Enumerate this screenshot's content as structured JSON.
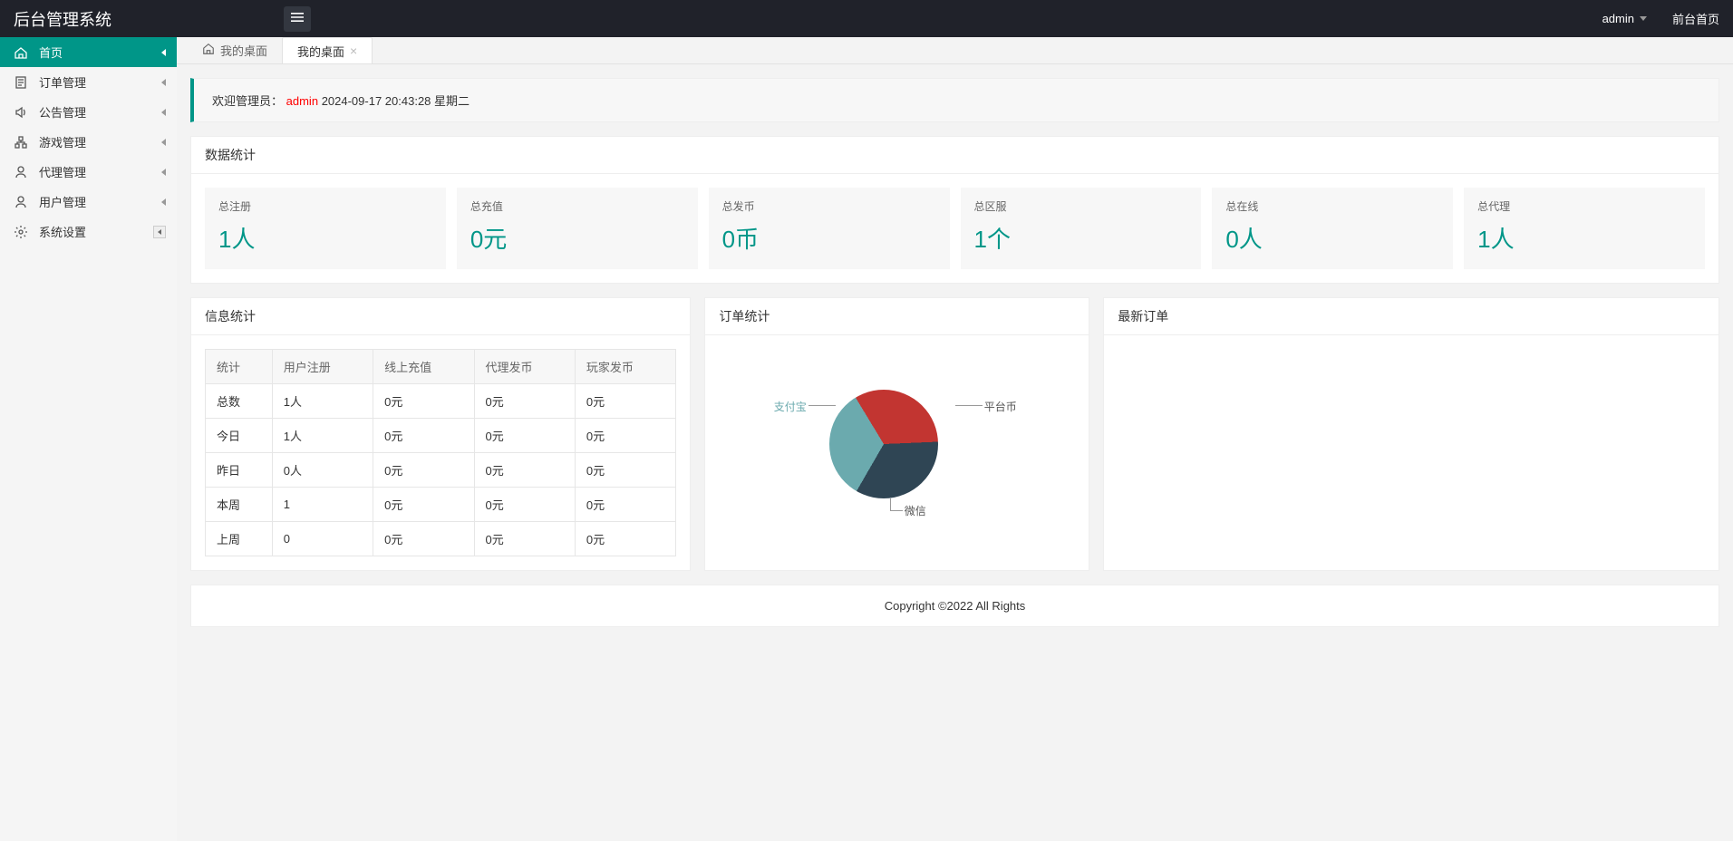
{
  "header": {
    "logo": "后台管理系统",
    "user": "admin",
    "front_link": "前台首页"
  },
  "sidebar": {
    "items": [
      {
        "label": "首页"
      },
      {
        "label": "订单管理"
      },
      {
        "label": "公告管理"
      },
      {
        "label": "游戏管理"
      },
      {
        "label": "代理管理"
      },
      {
        "label": "用户管理"
      },
      {
        "label": "系统设置"
      }
    ]
  },
  "tabs": {
    "home_label": "我的桌面",
    "active_label": "我的桌面"
  },
  "welcome": {
    "prefix": "欢迎管理员：",
    "admin": "admin",
    "datetime": " 2024-09-17  20:43:28  星期二"
  },
  "stats_panel": {
    "title": "数据统计",
    "cards": [
      {
        "label": "总注册",
        "value": "1人"
      },
      {
        "label": "总充值",
        "value": "0元"
      },
      {
        "label": "总发币",
        "value": "0币"
      },
      {
        "label": "总区服",
        "value": "1个"
      },
      {
        "label": "总在线",
        "value": "0人"
      },
      {
        "label": "总代理",
        "value": "1人"
      }
    ]
  },
  "info_panel": {
    "title": "信息统计",
    "headers": [
      "统计",
      "用户注册",
      "线上充值",
      "代理发币",
      "玩家发币"
    ],
    "rows": [
      [
        "总数",
        "1人",
        "0元",
        "0元",
        "0元"
      ],
      [
        "今日",
        "1人",
        "0元",
        "0元",
        "0元"
      ],
      [
        "昨日",
        "0人",
        "0元",
        "0元",
        "0元"
      ],
      [
        "本周",
        "1",
        "0元",
        "0元",
        "0元"
      ],
      [
        "上周",
        "0",
        "0元",
        "0元",
        "0元"
      ]
    ]
  },
  "order_panel": {
    "title": "订单统计"
  },
  "latest_panel": {
    "title": "最新订单"
  },
  "chart_data": {
    "type": "pie",
    "title": "订单统计",
    "series": [
      {
        "name": "支付宝",
        "value": 33,
        "color": "#6baaae"
      },
      {
        "name": "平台币",
        "value": 33,
        "color": "#c23531"
      },
      {
        "name": "微信",
        "value": 34,
        "color": "#2f4554"
      }
    ],
    "labels": {
      "alipay": "支付宝",
      "platform": "平台币",
      "wechat": "微信"
    }
  },
  "footer": {
    "copyright": "Copyright ©2022 All Rights"
  }
}
